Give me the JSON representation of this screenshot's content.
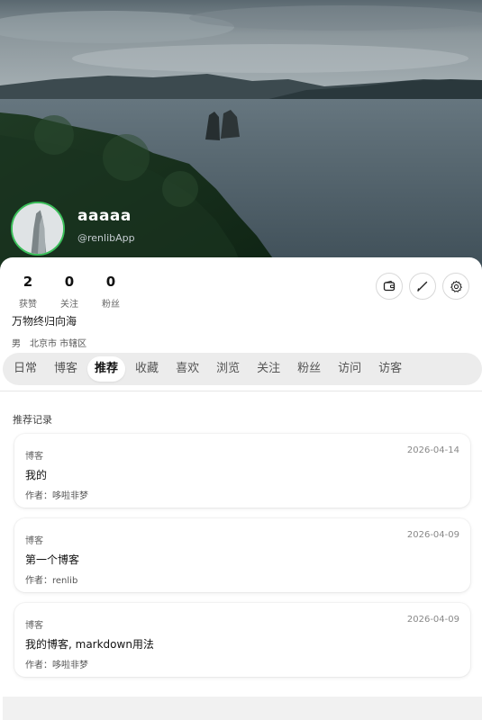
{
  "profile": {
    "username": "aaaaa",
    "handle": "@renlibApp",
    "bio": "万物终归向海",
    "gender": "男",
    "location": "北京市 市辖区"
  },
  "stats": [
    {
      "value": "2",
      "label": "获赞"
    },
    {
      "value": "0",
      "label": "关注"
    },
    {
      "value": "0",
      "label": "粉丝"
    }
  ],
  "actions": {
    "wallet_icon": "wallet-icon",
    "edit_icon": "pencil-icon",
    "settings_icon": "gear-icon"
  },
  "tabs": [
    {
      "label": "日常",
      "active": false
    },
    {
      "label": "博客",
      "active": false
    },
    {
      "label": "推荐",
      "active": true
    },
    {
      "label": "收藏",
      "active": false
    },
    {
      "label": "喜欢",
      "active": false
    },
    {
      "label": "浏览",
      "active": false
    },
    {
      "label": "关注",
      "active": false
    },
    {
      "label": "粉丝",
      "active": false
    },
    {
      "label": "访问",
      "active": false
    },
    {
      "label": "访客",
      "active": false
    }
  ],
  "section_title": "推荐记录",
  "records": [
    {
      "type": "博客",
      "date": "2026-04-14",
      "title": "我的",
      "author": "作者：哆啦非梦"
    },
    {
      "type": "博客",
      "date": "2026-04-09",
      "title": "第一个博客",
      "author": "作者：renlib"
    },
    {
      "type": "博客",
      "date": "2026-04-09",
      "title": "我的博客, markdown用法",
      "author": "作者：哆啦非梦"
    }
  ],
  "colors": {
    "avatar_ring": "#3bbf5a",
    "tab_bar_bg": "#ececec",
    "tab_active_bg": "#ffffff"
  }
}
